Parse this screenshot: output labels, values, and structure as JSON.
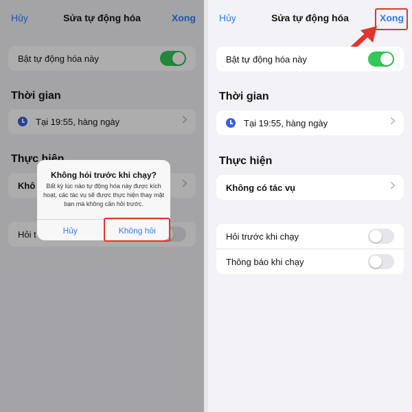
{
  "left": {
    "nav": {
      "cancel": "Hủy",
      "title": "Sửa tự động hóa",
      "done": "Xong"
    },
    "enable_label": "Bật tự động hóa này",
    "time_header": "Thời gian",
    "time_value": "Tại 19:55, hàng ngày",
    "action_header": "Thực hiện",
    "action_partial": "Khô",
    "ask_partial": "Hỏi t",
    "dialog": {
      "title": "Không hỏi trước khi chạy?",
      "body": "Bất kỳ lúc nào tự động hóa này được kích hoạt, các tác vụ sẽ được thực hiện thay mặt bạn mà không cần hỏi trước.",
      "cancel": "Hủy",
      "confirm": "Không hỏi"
    }
  },
  "right": {
    "nav": {
      "cancel": "Hủy",
      "title": "Sửa tự động hóa",
      "done": "Xong"
    },
    "enable_label": "Bật tự động hóa này",
    "time_header": "Thời gian",
    "time_value": "Tại 19:55, hàng ngày",
    "action_header": "Thực hiện",
    "no_action": "Không có tác vụ",
    "ask_before": "Hỏi trước khi chạy",
    "notify": "Thông báo khi chạy"
  },
  "toggles": {
    "enable_on": true,
    "ask_before_on": false,
    "notify_on": false
  },
  "colors": {
    "accent": "#2f7df6",
    "toggle_on": "#34c759",
    "highlight": "#e0352b"
  }
}
